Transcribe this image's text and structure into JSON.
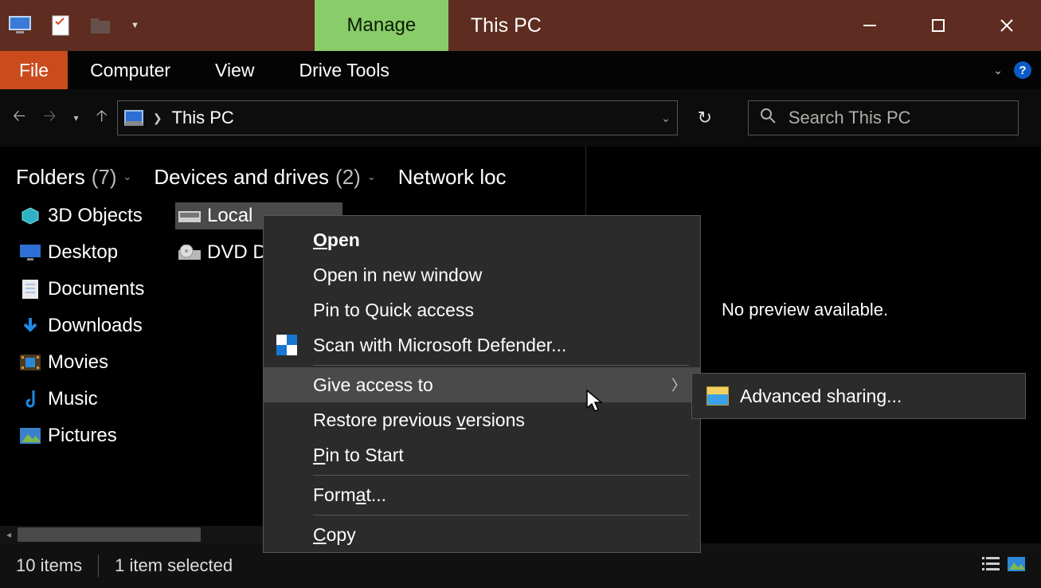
{
  "title_bar": {
    "context_tab": "Manage",
    "window_title": "This PC"
  },
  "ribbon": {
    "file": "File",
    "tabs": [
      "Computer",
      "View",
      "Drive Tools"
    ]
  },
  "nav": {
    "breadcrumb": "This PC",
    "search_placeholder": "Search This PC"
  },
  "headers": {
    "folders_label": "Folders",
    "folders_count": "(7)",
    "devices_label": "Devices and drives",
    "devices_count": "(2)",
    "network_label": "Network loc"
  },
  "folders": [
    "3D Objects",
    "Desktop",
    "Documents",
    "Downloads",
    "Movies",
    "Music",
    "Pictures"
  ],
  "devices": [
    "Local",
    "DVD D"
  ],
  "preview": {
    "message": "No preview available."
  },
  "context_menu": {
    "open": "Open",
    "open_new": "Open in new window",
    "pin_quick": "Pin to Quick access",
    "scan": "Scan with Microsoft Defender...",
    "give_access": "Give access to",
    "restore": "Restore previous versions",
    "pin_start": "Pin to Start",
    "format": "Format...",
    "copy": "Copy"
  },
  "submenu": {
    "advanced": "Advanced sharing..."
  },
  "status": {
    "items": "10 items",
    "selected": "1 item selected"
  }
}
